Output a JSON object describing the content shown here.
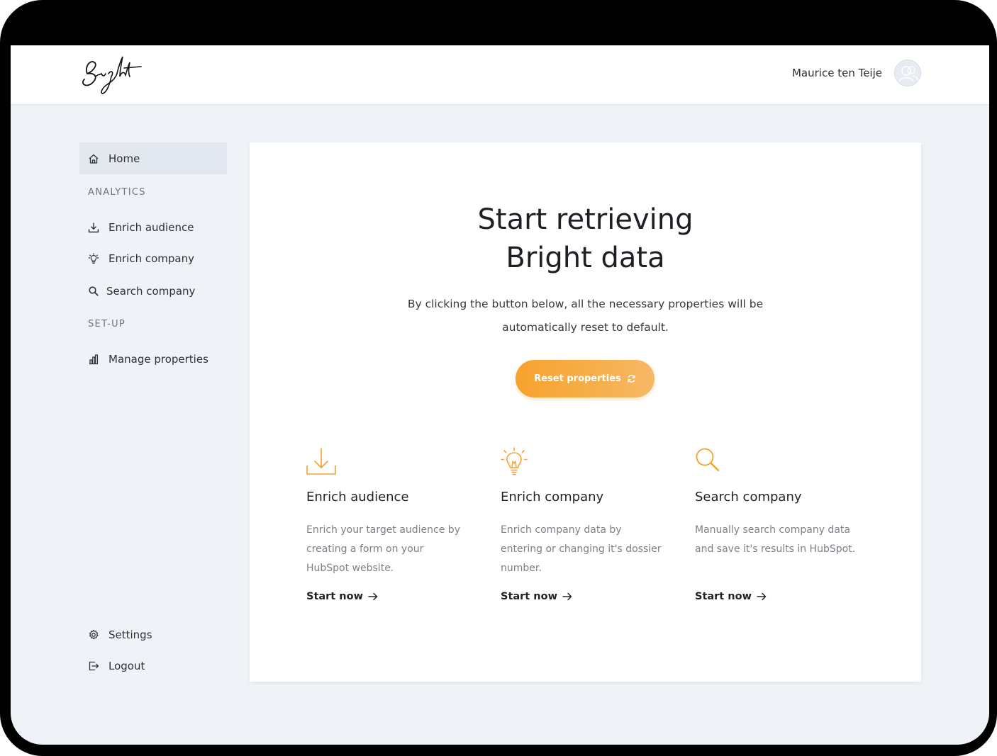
{
  "header": {
    "logo_text": "Bright",
    "user_name": "Maurice ten Teije"
  },
  "sidebar": {
    "home_label": "Home",
    "analytics_label": "ANALYTICS",
    "items_analytics": [
      {
        "label": "Enrich audience",
        "icon": "download-icon"
      },
      {
        "label": "Enrich company",
        "icon": "lightbulb-icon"
      },
      {
        "label": "Search company",
        "icon": "search-icon"
      }
    ],
    "setup_label": "SET-UP",
    "manage_label": "Manage properties",
    "settings_label": "Settings",
    "logout_label": "Logout"
  },
  "main": {
    "headline_line1": "Start retrieving",
    "headline_line2": "Bright data",
    "intro_line1": "By clicking the button below, all the necessary properties will be",
    "intro_line2": "automatically reset to default.",
    "reset_button": "Reset properties",
    "features": [
      {
        "title": "Enrich audience",
        "desc_lines": [
          "Enrich your target audience by",
          "creating a form on your",
          "HubSpot website."
        ],
        "link": "Start now",
        "icon": "download-icon"
      },
      {
        "title": "Enrich company",
        "desc_lines": [
          "Enrich company data by",
          "entering or changing it's dossier",
          "number."
        ],
        "link": "Start now",
        "icon": "lightbulb-icon"
      },
      {
        "title": "Search company",
        "desc_lines": [
          "Manually search company data",
          "and save it's results in HubSpot."
        ],
        "link": "Start now",
        "icon": "search-icon"
      }
    ]
  },
  "colors": {
    "accent": "#f7a22e",
    "background": "#eff2f6",
    "active_nav": "#e3e8f0"
  }
}
